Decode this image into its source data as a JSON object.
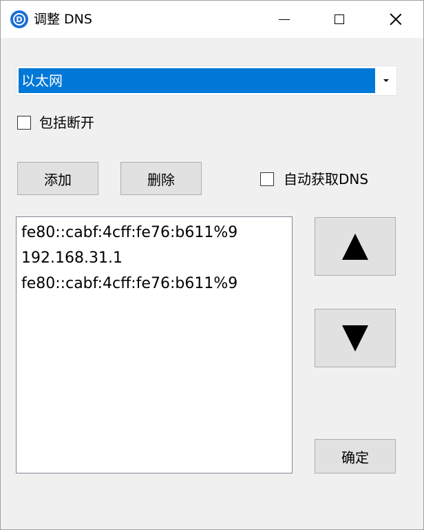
{
  "window": {
    "title": "调整 DNS",
    "icon": "app-d-icon",
    "icon_letter": "D",
    "accent_color": "#0078d7"
  },
  "adapter_select": {
    "selected": "以太网"
  },
  "include_disconnected": {
    "label": "包括断开",
    "checked": false
  },
  "buttons": {
    "add": "添加",
    "delete": "删除",
    "ok": "确定"
  },
  "auto_dns": {
    "label": "自动获取DNS",
    "checked": false
  },
  "dns_list": [
    "fe80::cabf:4cff:fe76:b611%9",
    "192.168.31.1",
    "fe80::cabf:4cff:fe76:b611%9"
  ],
  "move_buttons": {
    "up_icon": "triangle-up-icon",
    "down_icon": "triangle-down-icon"
  }
}
